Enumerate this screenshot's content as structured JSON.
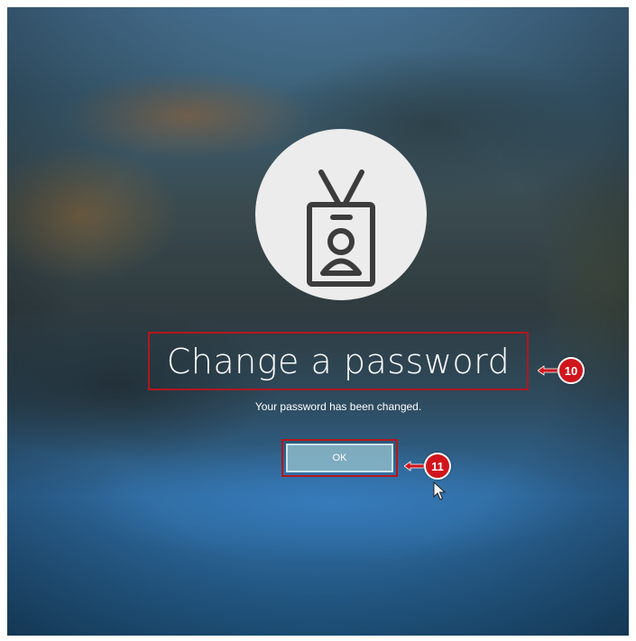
{
  "dialog": {
    "title": "Change a password",
    "message": "Your password has been changed.",
    "ok_label": "OK"
  },
  "annotations": [
    {
      "number": "10",
      "target": "title"
    },
    {
      "number": "11",
      "target": "ok-button"
    }
  ],
  "icons": {
    "avatar": "id-badge-user-icon",
    "cursor": "mouse-pointer-icon"
  },
  "colors": {
    "annotation_red": "#d0161c",
    "avatar_bg": "#ececec",
    "icon_stroke": "#3c3c3c",
    "button_bg": "#8cb9c8"
  }
}
